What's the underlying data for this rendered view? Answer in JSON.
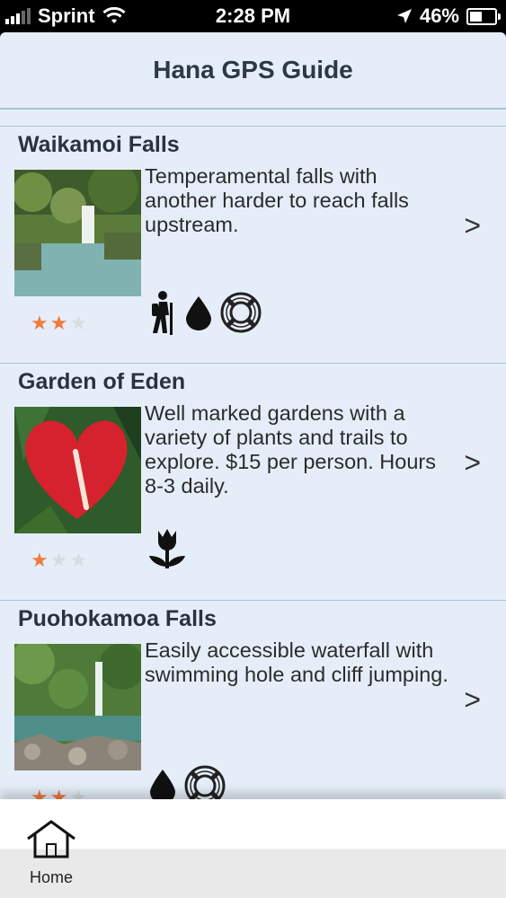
{
  "status_bar": {
    "carrier": "Sprint",
    "time": "2:28 PM",
    "battery": "46%",
    "battery_level": 0.46,
    "signal_icon": "signal-bars-icon",
    "wifi_icon": "wifi-icon",
    "location_icon": "location-arrow-icon"
  },
  "header": {
    "title": "Hana GPS Guide"
  },
  "items": [
    {
      "title": "Waikamoi Falls",
      "description": "Temperamental falls with another harder to reach falls upstream.",
      "rating": 2,
      "max_rating": 3,
      "icons": [
        "hiker-icon",
        "water-drop-icon",
        "life-ring-icon"
      ],
      "arrow": ">"
    },
    {
      "title": "Garden of Eden",
      "description": "Well marked gardens with a variety of plants and trails to explore. $15 per person. Hours 8-3 daily.",
      "rating": 1,
      "max_rating": 3,
      "icons": [
        "tulip-icon"
      ],
      "arrow": ">"
    },
    {
      "title": "Puohokamoa Falls",
      "description": "Easily accessible waterfall with swimming hole and cliff jumping.",
      "rating": 2,
      "max_rating": 3,
      "icons": [
        "water-drop-icon",
        "life-ring-icon"
      ],
      "arrow": ">"
    }
  ],
  "tab_bar": {
    "home_label": "Home",
    "home_icon": "home-icon"
  },
  "colors": {
    "background": "#e5eef8",
    "star": "#f07b3f",
    "divider": "#a7c3d5",
    "title_text": "#2d3847"
  }
}
